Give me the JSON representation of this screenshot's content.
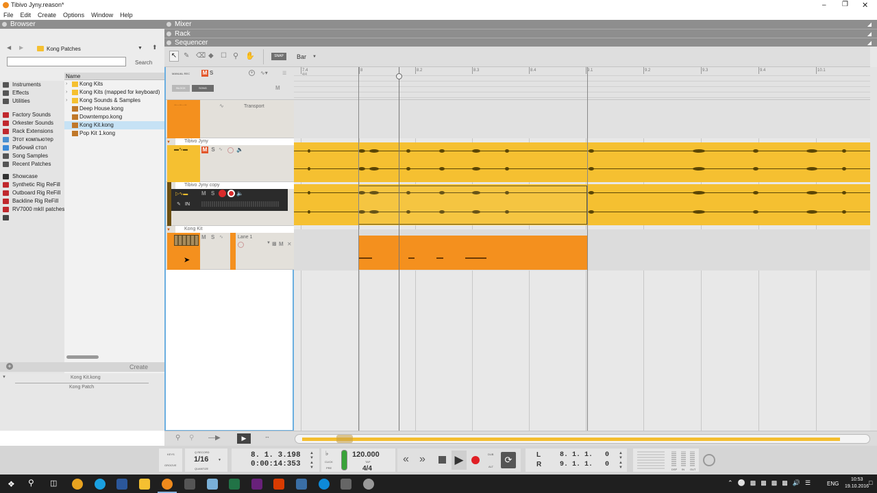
{
  "window": {
    "title": "Tibivo Jyny.reason*"
  },
  "menu": [
    "File",
    "Edit",
    "Create",
    "Options",
    "Window",
    "Help"
  ],
  "browser": {
    "title": "Browser",
    "location": "Kong Patches",
    "search_label": "Search",
    "search_placeholder": "",
    "places": [
      {
        "label": "Instruments",
        "color": "#555555"
      },
      {
        "label": "Effects",
        "color": "#555555"
      },
      {
        "label": "Utilities",
        "color": "#555555"
      },
      {
        "label": "Factory Sounds",
        "color": "#c0282d"
      },
      {
        "label": "Orkester Sounds",
        "color": "#c0282d"
      },
      {
        "label": "Rack Extensions",
        "color": "#c0282d"
      },
      {
        "label": "Этот компьютер",
        "color": "#4a90d0"
      },
      {
        "label": "Рабочий стол",
        "color": "#3a8ad8"
      },
      {
        "label": "Song Samples",
        "color": "#555555"
      },
      {
        "label": "Recent Patches",
        "color": "#555555"
      },
      {
        "label": "Showcase",
        "color": "#333333"
      },
      {
        "label": "Synthetic Rig ReFill",
        "color": "#c0282d"
      },
      {
        "label": "Outboard Rig ReFill",
        "color": "#c0282d"
      },
      {
        "label": "Backline Rig ReFill",
        "color": "#c0282d"
      },
      {
        "label": "RV7000 mkII patches",
        "color": "#c0282d"
      }
    ],
    "column_header": "Name",
    "files": [
      {
        "label": "Kong Kits",
        "type": "folder"
      },
      {
        "label": "Kong Kits (mapped for keyboard)",
        "type": "folder"
      },
      {
        "label": "Kong Sounds & Samples",
        "type": "folder"
      },
      {
        "label": "Deep House.kong",
        "type": "patch"
      },
      {
        "label": "Downtempo.kong",
        "type": "patch"
      },
      {
        "label": "Kong Kit.kong",
        "type": "patch",
        "selected": true
      },
      {
        "label": "Pop Kit 1.kong",
        "type": "patch"
      }
    ],
    "create_label": "Create",
    "info_name": "Kong Kit.kong",
    "info_type": "Kong Patch"
  },
  "panels": {
    "mixer": "Mixer",
    "rack": "Rack",
    "sequencer": "Sequencer"
  },
  "toolbar": {
    "snap": "SNAP",
    "snap_value": "Bar"
  },
  "header_ctrl": {
    "manual_rec": "MANUAL REC",
    "m": "M",
    "s": "S",
    "block": "BLOCK",
    "song": "SONG",
    "m2": "M"
  },
  "ruler": {
    "labels": [
      "7.4",
      "8",
      "8.2",
      "8.3",
      "8.4",
      "9.1",
      "9.2",
      "9.3",
      "9.4",
      "10.1"
    ],
    "time_sig": "4/4"
  },
  "tracks": {
    "transport": "Transport",
    "audio1": "Tibivo Jyny",
    "audio2": "Tibivo Jyny copy",
    "audio2_in": "IN",
    "kong": "Kong Kit",
    "lane": "Lane 1"
  },
  "transport_bar": {
    "keys": "KEYS",
    "groove": "GROOVE",
    "q_record": "Q RECORD",
    "quantize_value": "1/16",
    "quantize_label": "QUANTIZE",
    "position": "8. 1. 3.198",
    "time": "0:00:14:353",
    "click": "CLICK",
    "pre": "PRE",
    "tempo": "120.000",
    "tap": "TAP",
    "signature": "4/4",
    "dub": "DUB",
    "alt": "ALT",
    "loop_l_label": "L",
    "loop_l": "8. 1. 1.   0",
    "loop_r_label": "R",
    "loop_r": "9. 1. 1.   0",
    "dsp": "DSP",
    "in": "IN",
    "out": "OUT"
  },
  "system_tray": {
    "lang": "ENG",
    "time": "10:53",
    "date": "19.10.2016"
  },
  "colors": {
    "audio_clip": "#f4be2e",
    "note_clip": "#f4901e",
    "panel_header": "#8e8e8e",
    "selection_blue": "#c6e2f5"
  }
}
